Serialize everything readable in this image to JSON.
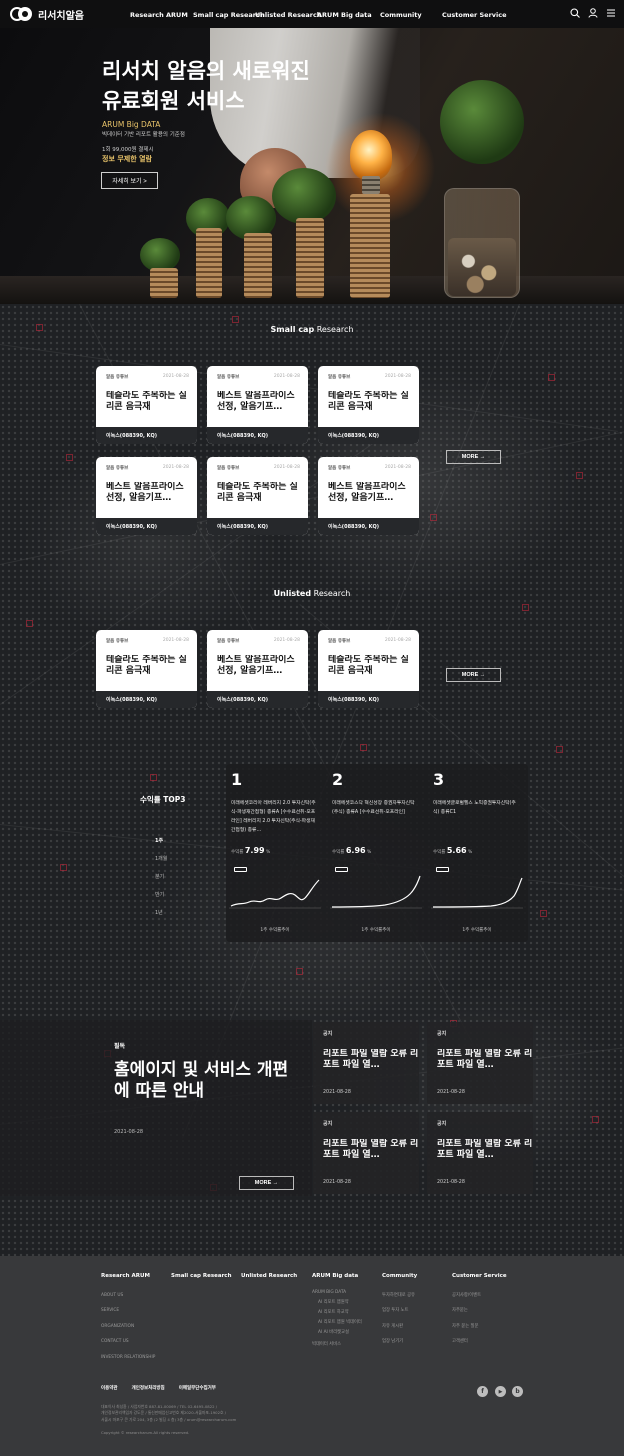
{
  "header": {
    "logo_text": "리서치알음",
    "menu": [
      "Research ARUM",
      "Small cap Research",
      "Unlisted Research",
      "ARUM Big data",
      "Community",
      "Customer Service"
    ]
  },
  "hero": {
    "title_line1": "리서치 알음의 새로워진",
    "title_line2": "유료회원 서비스",
    "sub1": "ARUM Big DATA",
    "sub2": "빅데이터 기반 리포트 활용의 기준점",
    "sub3": "1회 99,000원 결제시",
    "sub4": "정보 무제한 열람",
    "button": "자세히 보기 >"
  },
  "small_cap": {
    "title_bold": "Small cap",
    "title_rest": " Research",
    "cards": [
      {
        "tag": "알음 유튜브",
        "date": "2021-08-28",
        "title": "테슬라도 주목하는 실리콘 음극재",
        "foot": "이녹스(088390, KQ)"
      },
      {
        "tag": "알음 유튜브",
        "date": "2021-08-28",
        "title": "베스트 알음프라이스 선정, 알음기프…",
        "foot": "이녹스(088390, KQ)"
      },
      {
        "tag": "알음 유튜브",
        "date": "2021-08-28",
        "title": "테슬라도 주목하는 실리콘 음극재",
        "foot": "이녹스(088390, KQ)"
      },
      {
        "tag": "알음 유튜브",
        "date": "2021-08-28",
        "title": "베스트 알음프라이스 선정, 알음기프…",
        "foot": "이녹스(088390, KQ)"
      },
      {
        "tag": "알음 유튜브",
        "date": "2021-08-28",
        "title": "테슬라도 주목하는 실리콘 음극재",
        "foot": "이녹스(088390, KQ)"
      },
      {
        "tag": "알음 유튜브",
        "date": "2021-08-28",
        "title": "베스트 알음프라이스 선정, 알음기프…",
        "foot": "이녹스(088390, KQ)"
      }
    ],
    "more": "MORE →"
  },
  "unlisted": {
    "title_bold": "Unlisted",
    "title_rest": " Research",
    "cards": [
      {
        "tag": "알음 유튜브",
        "date": "2021-08-28",
        "title": "테슬라도 주목하는 실리콘 음극재",
        "foot": "이녹스(088390, KQ)"
      },
      {
        "tag": "알음 유튜브",
        "date": "2021-08-28",
        "title": "베스트 알음프라이스 선정, 알음기프…",
        "foot": "이녹스(088390, KQ)"
      },
      {
        "tag": "알음 유튜브",
        "date": "2021-08-28",
        "title": "테슬라도 주목하는 실리콘 음극재",
        "foot": "이녹스(088390, KQ)"
      }
    ],
    "more": "MORE →"
  },
  "top3": {
    "title": "수익률 TOP3",
    "periods": [
      "1주",
      "1개월",
      "분기",
      "반기",
      "1년"
    ],
    "active_period": "1주",
    "ranks": [
      {
        "num": "1",
        "name": "미래에셋코리아 레버리지 2.0 투자신탁(주식-파생재간접형) 종류A [수수료선취-오프라인] 레버리지 2.0 투자신탁(주식-파생재간접형) 종류…",
        "rate_label": "수익률",
        "rate": "7.99",
        "unit": "%",
        "caption": "1주 수익률추이"
      },
      {
        "num": "2",
        "name": "미래에셋코스닥 혁신성장 증권자투자신탁(주식) 종류A [수수료선취-오프라인]",
        "rate_label": "수익률",
        "rate": "6.96",
        "unit": "%",
        "caption": "1주 수익률추이"
      },
      {
        "num": "3",
        "name": "미래에셋글로벌헬스 노믹증권투자신탁(주식) 종류C1",
        "rate_label": "수익률",
        "rate": "5.66",
        "unit": "%",
        "caption": "1주 수익률추이"
      }
    ]
  },
  "notice": {
    "label": "필독",
    "title": "홈에이지 및 서비스 개편에 따른 안내",
    "date": "2021-08-28",
    "more": "MORE →",
    "cards": [
      {
        "label": "공지",
        "title": "리포트 파일 열람 오류 리포트 파일 열…",
        "date": "2021-08-28"
      },
      {
        "label": "공지",
        "title": "리포트 파일 열람 오류 리포트 파일 열…",
        "date": "2021-08-28"
      },
      {
        "label": "공지",
        "title": "리포트 파일 열람 오류 리포트 파일 열…",
        "date": "2021-08-28"
      },
      {
        "label": "공지",
        "title": "리포트 파일 열람 오류 리포트 파일 열…",
        "date": "2021-08-28"
      }
    ]
  },
  "footer": {
    "cols": [
      {
        "head": "Research ARUM",
        "items": [
          "ABOUT US",
          "SERVICE",
          "ORGANIZATION",
          "CONTACT US",
          "INVESTOR RELATIONSHIP"
        ]
      },
      {
        "head": "Small cap Research",
        "items": []
      },
      {
        "head": "Unlisted Research",
        "items": []
      },
      {
        "head": "ARUM Big data",
        "items": [
          "ARUM BIG DATA",
          "AI 리포트 앱원약",
          "AI 리포트 하교약",
          "AI 리포트 앱원 빅데이터",
          "AI AI 바리켓교설",
          "빅데이터 서비스"
        ]
      },
      {
        "head": "Community",
        "items": [
          "투자하면대로 공유",
          "업장 투자 노트",
          "자유 게시판",
          "업장 남기기"
        ]
      },
      {
        "head": "Customer Service",
        "items": [
          "공지사항/이벤트",
          "자주묻는",
          "자주 묻는 질문",
          "고객센터"
        ]
      }
    ],
    "links": [
      "이용약관",
      "개인정보처리방침",
      "이메일무단수집거부"
    ],
    "address_lines": [
      "대표이사 최성환 / 사업자번호 887-81-00069 / TEL 02-6495-0822 /",
      "개인정보관리책임자 강도윤 / 통신판매업신고번호 제2020-서울마포-1902호 /",
      "서울시 마포구 큰 가로 204, 3층 (2 빌딩 4 층) 3층 / arum@researcharum.com"
    ],
    "copyright": "Copyright © researcharum.All rights reserved.",
    "social": [
      "f",
      "▶",
      "b"
    ]
  }
}
